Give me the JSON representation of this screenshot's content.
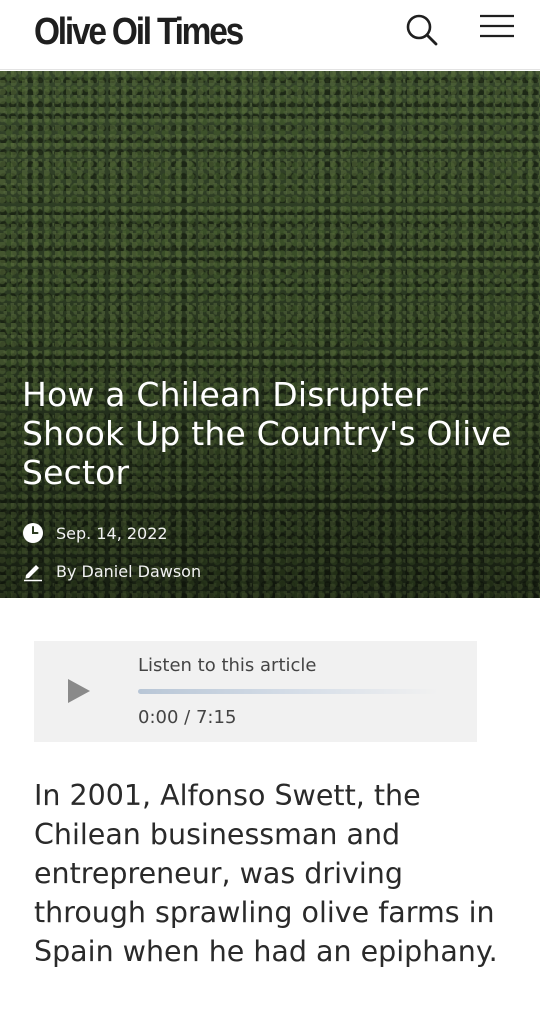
{
  "header": {
    "logo_text": "Olive Oil Times",
    "search_icon": "search-icon",
    "menu_icon": "hamburger-menu-icon"
  },
  "hero": {
    "title": "How a Chilean Disrupter Shook Up the Country's Olive Sector",
    "date": "Sep. 14, 2022",
    "author": "By Daniel Dawson",
    "date_icon": "clock-icon",
    "author_icon": "pencil-icon"
  },
  "player": {
    "label": "Listen to this article",
    "current_time": "0:00",
    "separator": "/",
    "duration": "7:15",
    "progress": 0,
    "play_icon": "play-icon"
  },
  "article": {
    "lead": "In 2001, Alfonso Swett, the Chilean businessman and entrepreneur, was driving through sprawling olive farms in Spain when he had an epiphany."
  },
  "colors": {
    "text": "#2a2a2a",
    "hero_text": "#ffffff",
    "player_bg": "#f1f1f1"
  }
}
